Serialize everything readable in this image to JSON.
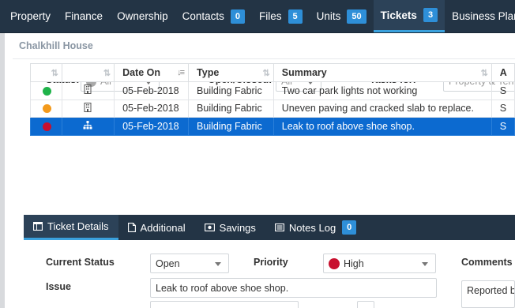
{
  "nav": {
    "tabs": [
      {
        "label": "Property"
      },
      {
        "label": "Finance"
      },
      {
        "label": "Ownership"
      },
      {
        "label": "Contacts",
        "badge": "0"
      },
      {
        "label": "Files",
        "badge": "5"
      },
      {
        "label": "Units",
        "badge": "50"
      },
      {
        "label": "Tickets",
        "badge": "3"
      },
      {
        "label": "Business Plan"
      }
    ]
  },
  "panel": {
    "title": "Chalkhill House"
  },
  "filters": {
    "status_label": "Status:",
    "status_value": "All",
    "openclosed_label": "Open/Closed:",
    "openclosed_value": "All",
    "tasks_label": "Tasks for:",
    "tasks_placeholder": "Property & Ten"
  },
  "table": {
    "headers": [
      "",
      "",
      "Date On",
      "Type",
      "Summary",
      "A"
    ],
    "rows": [
      {
        "status_color": "#1fb34a",
        "date": "05-Feb-2018",
        "type": "Building Fabric",
        "summary": "Two car park lights not working",
        "extra": "S",
        "icon": "building-icon"
      },
      {
        "status_color": "#f39a1c",
        "date": "05-Feb-2018",
        "type": "Building Fabric",
        "summary": "Uneven paving and cracked slab to replace.",
        "extra": "S",
        "icon": "building-icon"
      },
      {
        "status_color": "#c8102e",
        "date": "05-Feb-2018",
        "type": "Building Fabric",
        "summary": "Leak to roof above shoe shop.",
        "extra": "S",
        "icon": "hierarchy-icon",
        "selected": true
      }
    ]
  },
  "details_tabs": [
    {
      "label": "Ticket Details",
      "icon": "window-icon"
    },
    {
      "label": "Additional",
      "icon": "document-icon"
    },
    {
      "label": "Savings",
      "icon": "money-icon"
    },
    {
      "label": "Notes Log",
      "icon": "list-icon",
      "badge": "0"
    }
  ],
  "form": {
    "current_status_label": "Current Status",
    "current_status_value": "Open",
    "priority_label": "Priority",
    "priority_value": "High",
    "comments_label": "Comments",
    "comments_value": "Reported b",
    "issue_label": "Issue",
    "issue_value": "Leak to roof above shoe shop."
  },
  "colors": {
    "nav_bg": "#233445",
    "accent": "#3aa1dd",
    "badge": "#2e8fd8",
    "selected_row": "#0c6ad0"
  }
}
